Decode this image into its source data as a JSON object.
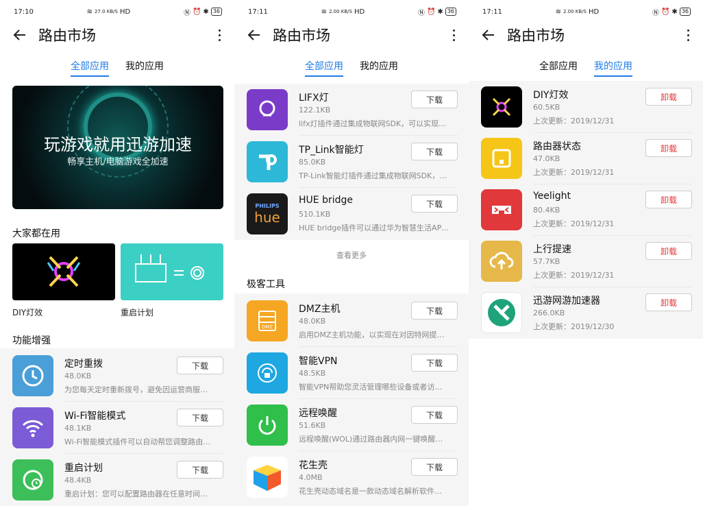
{
  "screens": [
    {
      "status": {
        "time": "17:10",
        "signal": "▐▐ ▐▐",
        "speed": "27.0 KB/S",
        "hd": "HD",
        "battery": "36"
      },
      "header": {
        "title": "路由市场"
      },
      "tabs": [
        {
          "label": "全部应用",
          "active": true
        },
        {
          "label": "我的应用",
          "active": false
        }
      ],
      "banner": {
        "title": "玩游戏就用迅游加速",
        "subtitle": "畅享主机/电脑游戏全加速"
      },
      "popular": {
        "heading": "大家都在用",
        "cards": [
          {
            "label": "DIY灯效"
          },
          {
            "label": "重启计划"
          }
        ]
      },
      "features": {
        "heading": "功能增强",
        "items": [
          {
            "name": "定时重拨",
            "size": "48.0KB",
            "desc": "为您每天定时重新拨号，避免因运营商服…",
            "button": "下载",
            "icon": "clock-icon",
            "color": "#4a9fd8"
          },
          {
            "name": "Wi-Fi智能模式",
            "size": "48.1KB",
            "desc": "Wi-Fi智能模式插件可以自动帮您调整路由…",
            "button": "下载",
            "icon": "wifi-icon",
            "color": "#7b5bd6"
          },
          {
            "name": "重启计划",
            "size": "48.4KB",
            "desc": "重启计划：您可以配置路由器在任意时间…",
            "button": "下载",
            "icon": "restart-clock-icon",
            "color": "#3cbf5a"
          }
        ]
      }
    },
    {
      "status": {
        "time": "17:11",
        "speed": "2.00 KB/S",
        "hd": "HD",
        "battery": "36"
      },
      "header": {
        "title": "路由市场"
      },
      "tabs": [
        {
          "label": "全部应用",
          "active": true
        },
        {
          "label": "我的应用",
          "active": false
        }
      ],
      "lights": {
        "items": [
          {
            "name": "LIFX灯",
            "size": "122.1KB",
            "desc": "lifx灯插件通过集成物联网SDK，可以实现…",
            "button": "下载",
            "icon": "bulb-icon",
            "color": "#7a3cc8"
          },
          {
            "name": "TP_Link智能灯",
            "size": "85.0KB",
            "desc": "TP-Link智能灯插件通过集成物联网SDK，…",
            "button": "下载",
            "icon": "tplink-logo-icon",
            "color": "#2eb8d8"
          },
          {
            "name": "HUE bridge",
            "size": "510.1KB",
            "desc": "HUE bridge插件可以通过华为智慧生活AP…",
            "button": "下载",
            "icon": "philips-hue-icon",
            "color": "#1a1a1a",
            "logo_top": "PHILIPS",
            "logo_bottom": "hue"
          }
        ],
        "more": "查看更多"
      },
      "geek": {
        "heading": "极客工具",
        "items": [
          {
            "name": "DMZ主机",
            "size": "48.0KB",
            "desc": "启用DMZ主机功能，以实现在对因特网提…",
            "button": "下载",
            "icon": "dmz-server-icon",
            "color": "#f5a623",
            "tag": "DMZ"
          },
          {
            "name": "智能VPN",
            "size": "48.5KB",
            "desc": "智能VPN帮助您灵活管理哪些设备或者访…",
            "button": "下载",
            "icon": "vpn-icon",
            "color": "#1ea7e0"
          },
          {
            "name": "远程唤醒",
            "size": "51.6KB",
            "desc": "远程唤醒(WOL)通过路由器内网一键唤醒…",
            "button": "下载",
            "icon": "power-icon",
            "color": "#2fbf4a"
          },
          {
            "name": "花生壳",
            "size": "4.0MB",
            "desc": "花生壳动态域名是一款动态域名解析软件…",
            "button": "下载",
            "icon": "peanut-cube-icon",
            "color": "#ffffff"
          }
        ]
      }
    },
    {
      "status": {
        "time": "17:11",
        "speed": "2.00 KB/S",
        "hd": "HD",
        "battery": "36"
      },
      "header": {
        "title": "路由市场"
      },
      "tabs": [
        {
          "label": "全部应用",
          "active": false
        },
        {
          "label": "我的应用",
          "active": true
        }
      ],
      "mine": {
        "items": [
          {
            "name": "DIY灯效",
            "size": "60.5KB",
            "updated": "上次更新：2019/12/31",
            "button": "卸载",
            "icon": "diy-light-icon",
            "color": "#000000"
          },
          {
            "name": "路由器状态",
            "size": "47.0KB",
            "updated": "上次更新：2019/12/31",
            "button": "卸载",
            "icon": "router-status-icon",
            "color": "#f5c518"
          },
          {
            "name": "Yeelight",
            "size": "80.4KB",
            "updated": "上次更新：2019/12/31",
            "button": "卸载",
            "icon": "yeelight-icon",
            "color": "#e0383b"
          },
          {
            "name": "上行提速",
            "size": "57.7KB",
            "updated": "上次更新：2019/12/31",
            "button": "卸载",
            "icon": "cloud-upload-icon",
            "color": "#e6b84a"
          },
          {
            "name": "迅游网游加速器",
            "size": "266.0KB",
            "updated": "上次更新：2019/12/30",
            "button": "卸载",
            "icon": "xunyou-icon",
            "color": "#ffffff"
          }
        ]
      }
    }
  ]
}
